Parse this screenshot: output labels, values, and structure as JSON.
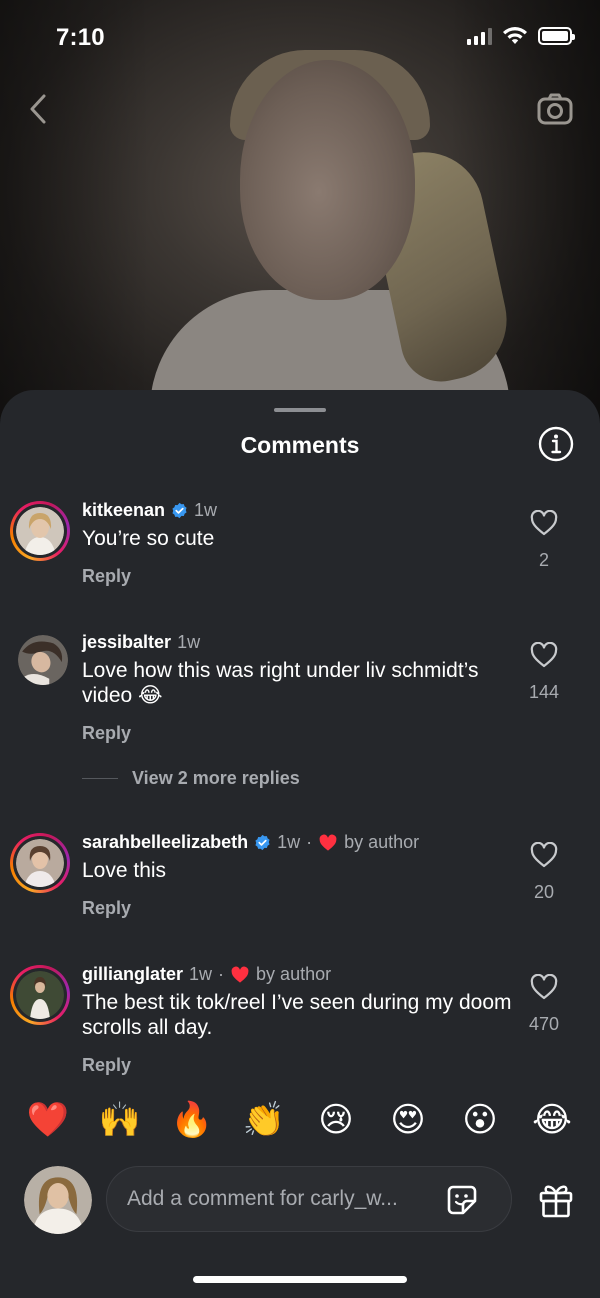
{
  "status_bar": {
    "time": "7:10"
  },
  "sheet": {
    "title": "Comments"
  },
  "comments": [
    {
      "username": "kitkeenan",
      "verified": true,
      "age": "1w",
      "by_author": false,
      "text": "You’re so cute",
      "reply_label": "Reply",
      "likes": "2"
    },
    {
      "username": "jessibalter",
      "verified": false,
      "age": "1w",
      "by_author": false,
      "text": "Love how this was right under liv schmidt’s video 😂",
      "reply_label": "Reply",
      "likes": "144"
    },
    {
      "username": "sarahbelleelizabeth",
      "verified": true,
      "age": "1w",
      "by_author": true,
      "by_author_label": "by author",
      "text": "Love this",
      "reply_label": "Reply",
      "likes": "20"
    },
    {
      "username": "gillianglater",
      "verified": false,
      "age": "1w",
      "by_author": true,
      "by_author_label": "by author",
      "text": "The best tik tok/reel I’ve seen during my doom scrolls all day.",
      "reply_label": "Reply",
      "likes": "470"
    }
  ],
  "view_more_replies": "View 2 more replies",
  "separator": "·",
  "quick_reactions": [
    "❤️",
    "🙌",
    "🔥",
    "👏",
    "😢",
    "😍",
    "😮",
    "😂"
  ],
  "composer": {
    "placeholder": "Add a comment for carly_w..."
  },
  "colors": {
    "sheet_bg": "#25272b",
    "secondary_text": "#a8abb0",
    "verified_blue": "#3897f0",
    "heart_red": "#ff3040"
  }
}
